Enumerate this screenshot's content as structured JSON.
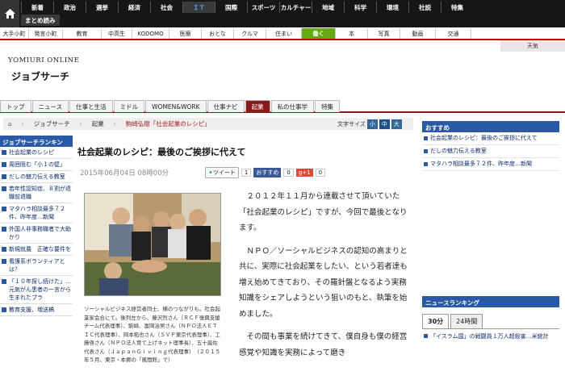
{
  "top_nav": {
    "items": [
      "新着",
      "政治",
      "選挙",
      "経済",
      "社会",
      "ＩＴ",
      "国際",
      "スポーツ",
      "カルチャー",
      "地域",
      "科学",
      "環境",
      "社説",
      "特集"
    ],
    "active_index": 5
  },
  "matome_label": "まとめ読み",
  "sub_nav": {
    "items": [
      "大手小町",
      "発言小町",
      "教育",
      "中高生",
      "KODOMO",
      "医療",
      "おとな",
      "クルマ",
      "住まい",
      "働く",
      "本",
      "写真",
      "動画",
      "交通"
    ],
    "highlight_index": 9
  },
  "weather_label": "天気",
  "site": {
    "brand": "YOMIURI ONLINE",
    "section": "ジョブサーチ"
  },
  "tabs": {
    "items": [
      "トップ",
      "ニュース",
      "仕事と生活",
      "ミドル",
      "WOMEN&WORK",
      "仕事ナビ",
      "起業",
      "私の仕事学",
      "特集"
    ],
    "active_index": 6
  },
  "breadcrumb": {
    "items": [
      "ジョブサーチ",
      "起業"
    ],
    "current": "駒崎弘樹「社会起業のレシピ」"
  },
  "font_size": {
    "label": "文字サイズ",
    "options": [
      "小",
      "中",
      "大"
    ],
    "active_index": 1
  },
  "left_sidebar": {
    "title": "ジョブサーチランキン",
    "items": [
      "社会起業のレシピ",
      "周囲阻む「小１の壁」",
      "だしの魅力伝える教室",
      "若年性認知症、８割が退職前退職",
      "マタハラ相談最多７２件、昨年度…新聞",
      "外国人非事務職者で大助かり",
      "新規就農　正確な要件を",
      "看護系ボランティアとは？",
      "「１０年探し続けた」…元気がん患者の一言から生まれたプラ",
      "教育支援、増送稿"
    ]
  },
  "article": {
    "title": "社会起業のレシピ：最後のご挨拶に代えて",
    "date": "2015年06月04日 08時00分",
    "tweet_label": "ツイート",
    "tweet_count": "1",
    "fb_label": "おすすめ",
    "fb_count": "0",
    "gplus_label": "g+1",
    "gplus_count": "0",
    "caption": "ソーシャルビジネス経営者同士、横のつながりも。社会起業家会合にて。後列左から、藤沢烈さん（ＲＣＦ復興支援チーム代表理事）、駒崎、富岡治男さん（ＮＰＯ法人ＥＴＩＣ代表理事）、岡本拓也さん（ＳＶＰ東京代表理事）、工藤啓さん（ＮＰＯ法人育て上げネット理事長）、五十嵐佐代表さん（ＪａｐａｎＧｉｖｉｎｇ代表理事）　（２０１５年５月、東京・本郷の「風間館」で）",
    "paragraphs": [
      "２０１２年１１月から連載させて頂いていた「社会起業のレシピ」ですが、今回で最後となります。",
      "ＮＰＯ／ソーシャルビジネスの認知の高まりと共に、実際に社会起業をしたい、という若者達も増え始めてきており、その羅針盤となるよう実務知識をシェアしようという狙いのもと、執筆を始めました。",
      "その間も事業を続けてきて、僕自身も僕の経営感覚や知識を実務によって磨き"
    ]
  },
  "right_sidebar": {
    "title": "おすすめ",
    "items": [
      "社会起業のレシピ：最後のご挨拶に代えて",
      "だしの魅力伝える教室",
      "マタハラ相談最多７２件、昨年度…新聞"
    ]
  },
  "ranking": {
    "title": "ニュースランキング",
    "tabs": [
      "30分",
      "24時間"
    ],
    "active_tab": 0,
    "first_item": "「イスラム国」の戦闘員１万人超殺害…米統計"
  },
  "colors": {
    "accent_blue": "#2a5aa5",
    "tab_red": "#8a1a1a",
    "highlight_green": "#6a1"
  }
}
